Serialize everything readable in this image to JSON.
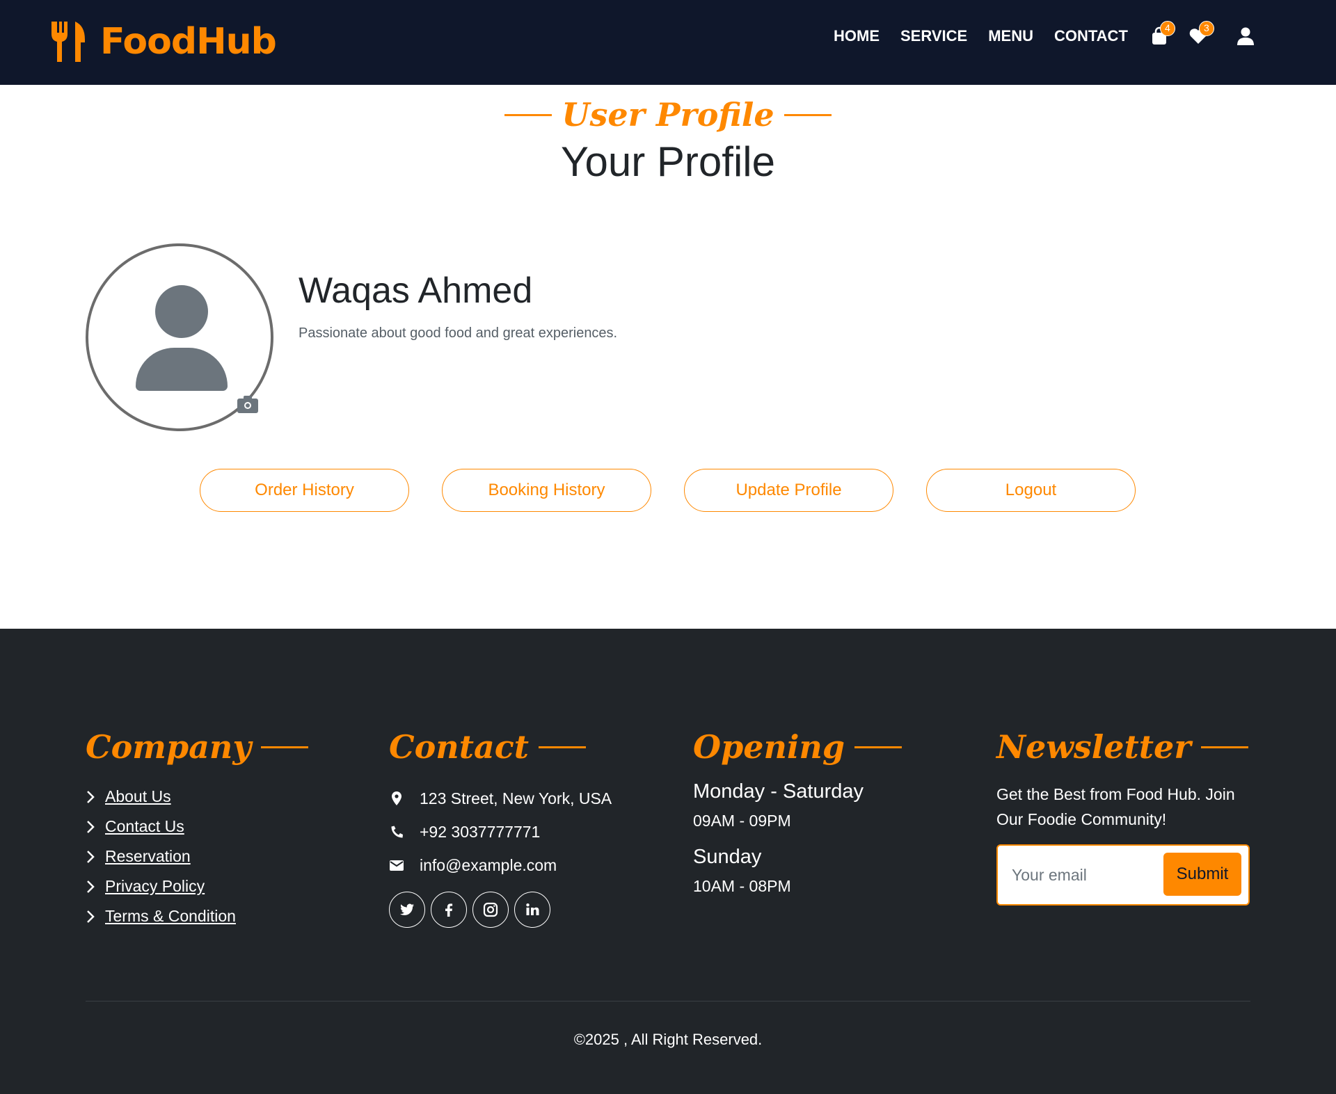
{
  "brand": {
    "name": "FoodHub",
    "accent_color": "#fe8800",
    "icon": "utensils-icon"
  },
  "nav": {
    "links": [
      "HOME",
      "SERVICE",
      "MENU",
      "CONTACT"
    ],
    "cart_count": "4",
    "wishlist_count": "3"
  },
  "page": {
    "sub_heading": "User Profile",
    "heading": "Your Profile"
  },
  "profile": {
    "name": "Waqas Ahmed",
    "bio": "Passionate about good food and great experiences."
  },
  "actions": [
    "Order History",
    "Booking History",
    "Update Profile",
    "Logout"
  ],
  "footer": {
    "company": {
      "title": "Company",
      "links": [
        "About Us",
        "Contact Us",
        "Reservation",
        "Privacy Policy",
        "Terms & Condition"
      ]
    },
    "contact": {
      "title": "Contact",
      "address": "123 Street, New York, USA",
      "phone": "+92 3037777771",
      "email": "info@example.com",
      "socials": [
        "twitter-icon",
        "facebook-icon",
        "instagram-icon",
        "linkedin-icon"
      ]
    },
    "opening": {
      "title": "Opening",
      "day1": "Monday - Saturday",
      "time1": "09AM - 09PM",
      "day2": "Sunday",
      "time2": "10AM - 08PM"
    },
    "newsletter": {
      "title": "Newsletter",
      "text": "Get the Best from Food Hub. Join Our Foodie Community!",
      "placeholder": "Your email",
      "button": "Submit"
    },
    "copyright": "©2025 , All Right Reserved."
  }
}
